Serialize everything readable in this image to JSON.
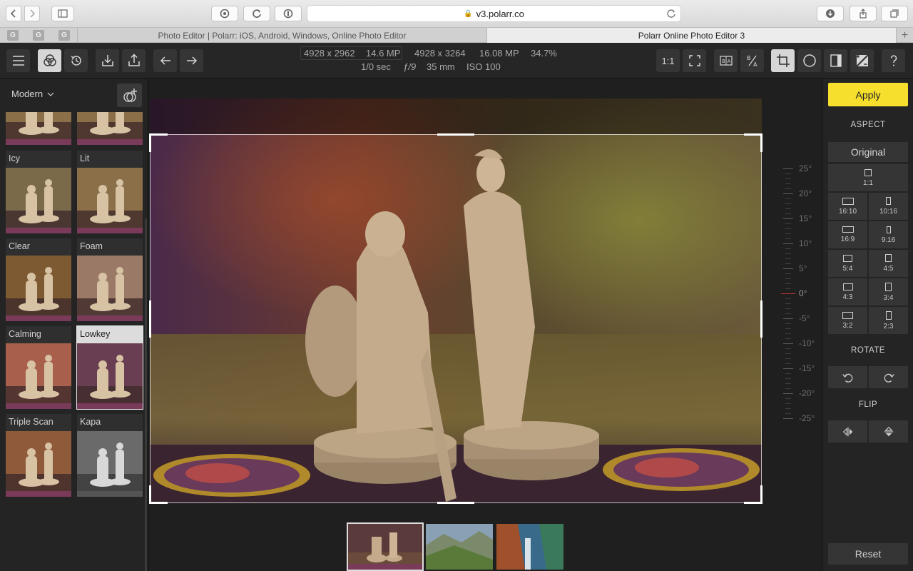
{
  "browser": {
    "url": "v3.polarr.co",
    "pinned_tabs": [
      "G",
      "G",
      "G"
    ],
    "tabs": [
      {
        "title": "Photo Editor | Polarr: iOS, Android, Windows, Online Photo Editor"
      },
      {
        "title": "Polarr Online Photo Editor 3"
      }
    ],
    "new_tab": "+"
  },
  "toolbar": {
    "meta": {
      "crop_size": "4928 x 2962",
      "crop_mp": "14.6 MP",
      "orig_size": "4928 x 3264",
      "orig_mp": "16.08 MP",
      "zoom": "34.7%",
      "shutter": "1/0 sec",
      "aperture": "ƒ/9",
      "focal": "35 mm",
      "iso": "ISO 100"
    },
    "zoom_1to1": "1:1",
    "compare_label": "BA"
  },
  "left_panel": {
    "preset_group": "Modern",
    "filters": [
      {
        "name": "Icy",
        "tone": "#7a6a4a"
      },
      {
        "name": "Lit",
        "tone": "#8a6f48"
      },
      {
        "name": "Clear",
        "tone": "#7d5a32"
      },
      {
        "name": "Foam",
        "tone": "#9a7a66"
      },
      {
        "name": "Calming",
        "tone": "#a8604c"
      },
      {
        "name": "Lowkey",
        "tone": "#6a3e52",
        "selected": true
      },
      {
        "name": "Triple Scan",
        "tone": "#8f5a3a"
      },
      {
        "name": "Kapa",
        "tone": "#6a6a6a",
        "mono": true
      }
    ]
  },
  "ruler": {
    "degrees": [
      "25°",
      "20°",
      "15°",
      "10°",
      "5°",
      "0°",
      "-5°",
      "-10°",
      "-15°",
      "-20°",
      "-25°"
    ],
    "current": "0°"
  },
  "right_panel": {
    "apply": "Apply",
    "aspect_title": "ASPECT",
    "original": "Original",
    "aspects": [
      {
        "label": "1:1",
        "w": 10,
        "h": 10
      },
      {
        "label": "16:10",
        "w": 16,
        "h": 10
      },
      {
        "label": "10:16",
        "w": 7,
        "h": 11
      },
      {
        "label": "16:9",
        "w": 16,
        "h": 9
      },
      {
        "label": "9:16",
        "w": 6,
        "h": 10
      },
      {
        "label": "5:4",
        "w": 13,
        "h": 10
      },
      {
        "label": "4:5",
        "w": 9,
        "h": 11
      },
      {
        "label": "4:3",
        "w": 14,
        "h": 10
      },
      {
        "label": "3:4",
        "w": 9,
        "h": 12
      },
      {
        "label": "3:2",
        "w": 15,
        "h": 10
      },
      {
        "label": "2:3",
        "w": 8,
        "h": 12
      }
    ],
    "rotate_title": "ROTATE",
    "flip_title": "FLIP",
    "reset": "Reset"
  },
  "colors": {
    "accent": "#f7df2d",
    "panel": "#242424",
    "button": "#353535"
  }
}
